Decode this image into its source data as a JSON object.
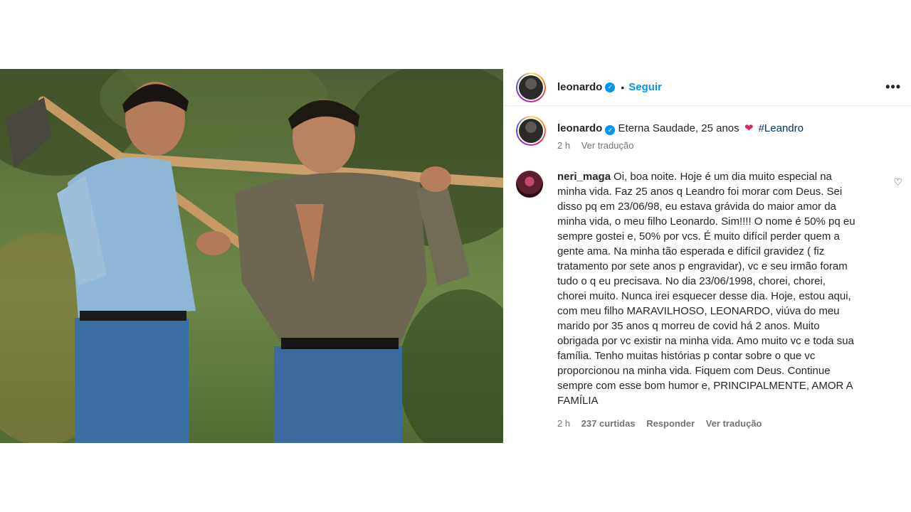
{
  "post": {
    "author": "leonardo",
    "follow_label": "Seguir",
    "dot": "•",
    "more_label": "•••",
    "verified_mark": "✓"
  },
  "caption": {
    "username": "leonardo",
    "text": "Eterna Saudade, 25 anos",
    "emoji": "❤",
    "hashtag": "#Leandro",
    "time": "2 h",
    "translate": "Ver tradução"
  },
  "comment": {
    "username": "neri_maga",
    "text": "Oi, boa noite. Hoje é um dia muito especial na\nminha vida. Faz 25 anos q Leandro foi morar com Deus. Sei\ndisso pq em 23/06/98, eu estava grávida do maior amor da\nminha vida, o meu filho Leonardo. Sim!!!! O nome é 50% pq eu\nsempre gostei e, 50% por vcs. É muito difícil perder quem a\ngente ama. Na minha tão esperada e difícil gravidez ( fiz\ntratamento por sete anos p engravidar), vc e seu irmão foram\ntudo o q eu precisava. No dia 23/06/1998, chorei, chorei,\nchorei muito. Nunca irei esquecer desse dia. Hoje, estou aqui,\ncom meu filho MARAVILHOSO, LEONARDO, viúva do meu\nmarido por 35 anos q morreu de covid há 2 anos. Muito\nobrigada por vc existir na minha vida. Amo muito vc e toda sua\nfamília. Tenho muitas histórias p contar sobre o que vc\nproporcionou na minha vida. Fiquem com Deus. Continue\nsempre com esse bom humor e, PRINCIPALMENTE, AMOR A\nFAMÍLIA",
    "time": "2 h",
    "likes": "237 curtidas",
    "reply": "Responder",
    "translate": "Ver tradução",
    "like_icon": "♡"
  }
}
